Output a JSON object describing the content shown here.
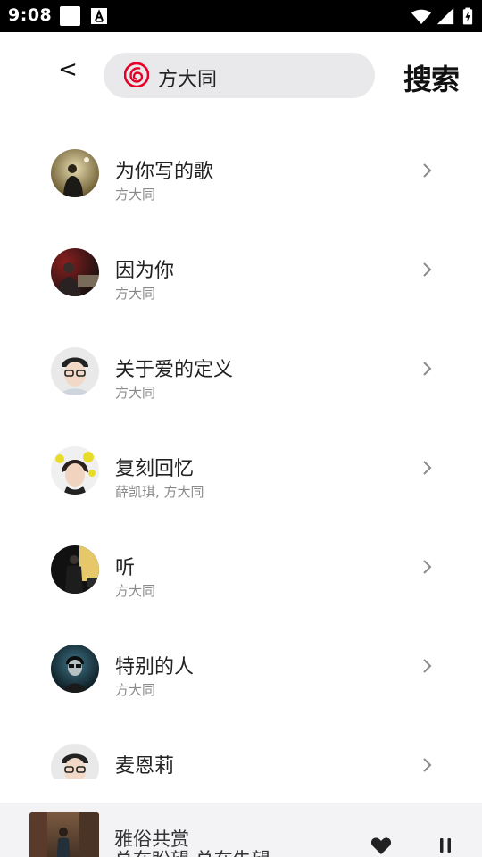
{
  "status_bar": {
    "time": "9:08",
    "icons": [
      "notification-square-icon",
      "notification-a-icon",
      "wifi-icon",
      "cell-signal-icon",
      "battery-charging-icon"
    ]
  },
  "header": {
    "back_label": "<",
    "search_value": "方大同",
    "search_button_label": "搜索",
    "brand_color": "#e4002b"
  },
  "songs": [
    {
      "title": "为你写的歌",
      "artist": "方大同"
    },
    {
      "title": "因为你",
      "artist": "方大同"
    },
    {
      "title": "关于爱的定义",
      "artist": "方大同"
    },
    {
      "title": "复刻回忆",
      "artist": "薛凯琪, 方大同"
    },
    {
      "title": "听",
      "artist": "方大同"
    },
    {
      "title": "特别的人",
      "artist": "方大同"
    },
    {
      "title": "麦恩莉",
      "artist": ""
    }
  ],
  "mini_player": {
    "title": "雅俗共赏",
    "subtitle": "总在盼望 总在失望"
  }
}
